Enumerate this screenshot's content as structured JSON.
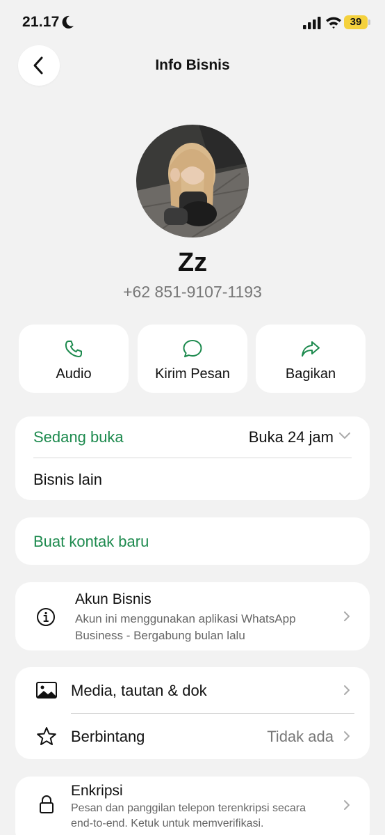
{
  "status_bar": {
    "time": "21.17",
    "battery": "39"
  },
  "nav": {
    "title": "Info Bisnis"
  },
  "profile": {
    "name": "Zz",
    "phone": "+62 851-9107-1193"
  },
  "actions": [
    {
      "label": "Audio",
      "icon": "phone-icon"
    },
    {
      "label": "Kirim Pesan",
      "icon": "message-icon"
    },
    {
      "label": "Bagikan",
      "icon": "share-icon"
    }
  ],
  "hours": {
    "status": "Sedang buka",
    "value": "Buka 24 jam",
    "other": "Bisnis lain"
  },
  "contact": {
    "new_contact": "Buat kontak baru"
  },
  "business_account": {
    "title": "Akun Bisnis",
    "line1": "Akun ini menggunakan aplikasi WhatsApp",
    "line2": "Business - Bergabung bulan lalu"
  },
  "media": {
    "media_label": "Media, tautan & dok",
    "starred_label": "Berbintang",
    "starred_value": "Tidak ada"
  },
  "encryption": {
    "title": "Enkripsi",
    "line1": "Pesan dan panggilan telepon terenkripsi secara",
    "line2": "end-to-end. Ketuk untuk memverifikasi."
  },
  "colors": {
    "accent_green": "#1d8a4e",
    "background": "#f2f2f2",
    "battery": "#f4d13d"
  }
}
